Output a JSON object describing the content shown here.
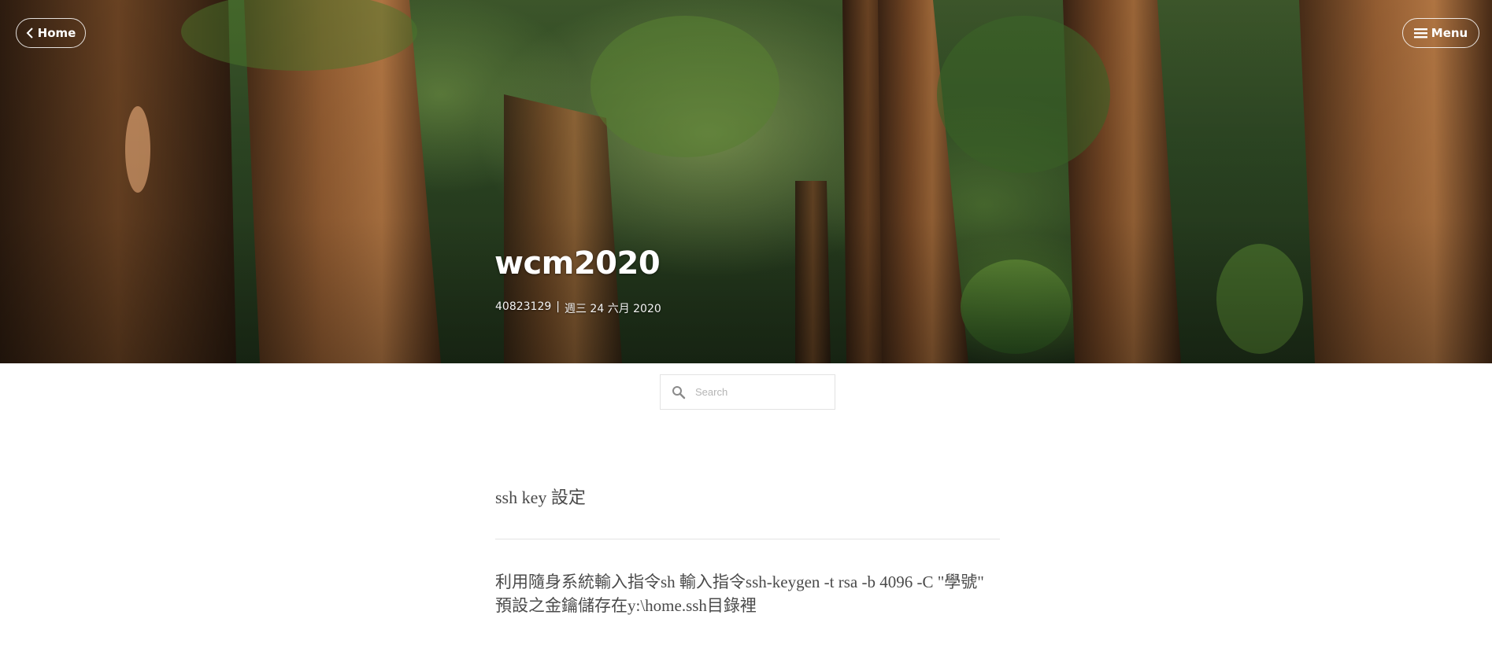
{
  "header": {
    "home_label": "Home",
    "menu_label": "Menu",
    "title": "wcm2020",
    "author": "40823129",
    "separator": "|",
    "date": "週三 24 六月 2020"
  },
  "search": {
    "placeholder": "Search"
  },
  "post": {
    "title": "ssh key 設定",
    "body": "利用隨身系統輸入指令sh 輸入指令ssh-keygen -t rsa -b 4096 -C \"學號\" 預設之金鑰儲存在y:\\home.ssh目錄裡"
  }
}
